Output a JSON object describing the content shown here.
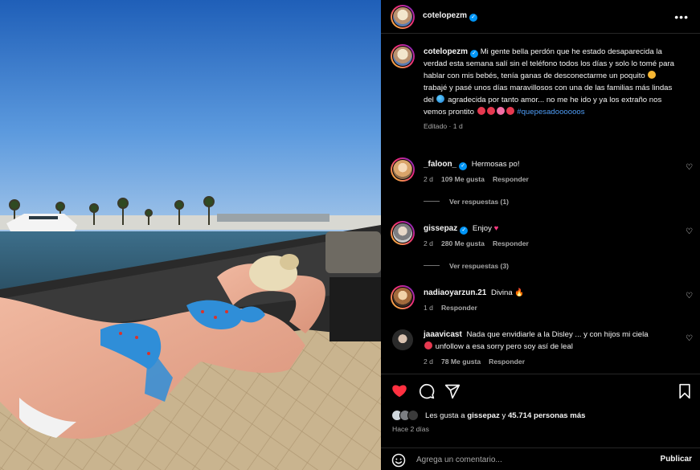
{
  "post": {
    "username": "cotelopezm",
    "more_icon": "more-dots-icon",
    "verified_icon": "verified-badge-icon"
  },
  "caption": {
    "username": "cotelopezm",
    "text_1": "Mi gente bella perdón que he estado desaparecida la verdad esta semana salí sin el teléfono todos los días y solo lo tomé para hablar con mis bebés, tenía ganas de desconectarme un poquito",
    "text_2": "trabajé y pasé unos días maravillosos con una de las familias más lindas del",
    "text_3": "agradecida por tanto amor... no me he ido y ya los extraño nos vemos prontito",
    "hashtag": "#quepesadoooooos",
    "edited": "Editado · 1 d"
  },
  "comments": [
    {
      "username": "_faloon_",
      "verified": true,
      "text": "Hermosas po!",
      "time": "2 d",
      "likes": "109 Me gusta",
      "reply": "Responder",
      "view_replies": "Ver respuestas (1)"
    },
    {
      "username": "gissepaz",
      "verified": true,
      "text": "Enjoy",
      "time": "2 d",
      "likes": "280 Me gusta",
      "reply": "Responder",
      "view_replies": "Ver respuestas (3)"
    },
    {
      "username": "nadiaoyarzun.21",
      "verified": false,
      "text": "Divina",
      "time": "1 d",
      "reply": "Responder"
    },
    {
      "username": "jaaavicast",
      "verified": false,
      "text": "Nada que envidiarle a la Disley ... y con hijos mi ciela",
      "text_2": "unfollow a esa sorry pero soy así de leal",
      "time": "2 d",
      "likes": "78 Me gusta",
      "reply": "Responder"
    }
  ],
  "actions": {
    "like_icon": "heart-filled-icon",
    "comment_icon": "comment-bubble-icon",
    "share_icon": "paper-plane-icon",
    "save_icon": "bookmark-icon",
    "like_color": "#ff3040"
  },
  "likes": {
    "prefix": "Les gusta a",
    "user": "gissepaz",
    "joiner": "y",
    "count": "45.714 personas más"
  },
  "posted_ago": "Hace 2 días",
  "composer": {
    "placeholder": "Agrega un comentario...",
    "post_label": "Publicar"
  }
}
